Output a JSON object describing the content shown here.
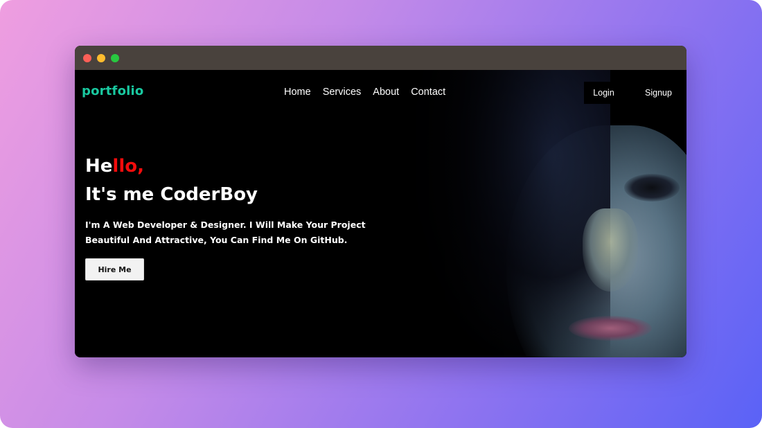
{
  "window": {
    "controls": [
      "close",
      "minimize",
      "maximize"
    ]
  },
  "navbar": {
    "logo": "portfolio",
    "links": [
      "Home",
      "Services",
      "About",
      "Contact"
    ],
    "login_label": "Login",
    "signup_label": "Signup"
  },
  "hero": {
    "hello_plain": "He",
    "hello_accent": "llo,",
    "headline": "It's me CoderBoy",
    "description": "I'm A Web Developer & Designer. I Will Make Your Project Beautiful And Attractive, You Can Find Me On GitHub.",
    "cta_label": "Hire Me"
  },
  "colors": {
    "logo": "#19c9a0",
    "accent": "#f30c0c",
    "titlebar": "#49423d",
    "close": "#fd5f57",
    "minimize": "#febc2e",
    "maximize": "#28c840"
  }
}
